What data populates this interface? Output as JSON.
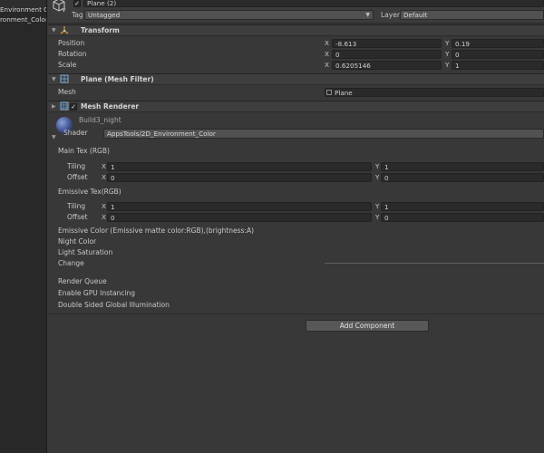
{
  "hierarchy": {
    "items": [
      "Environment Co",
      "ronment_Color"
    ]
  },
  "header": {
    "object_name": "Plane (2)",
    "tag_label": "Tag",
    "tag_value": "Untagged",
    "layer_label": "Layer",
    "layer_value": "Default"
  },
  "transform": {
    "title": "Transform",
    "rows": [
      {
        "label": "Position",
        "x": "-8.613",
        "y": "0.19"
      },
      {
        "label": "Rotation",
        "x": "0",
        "y": "0"
      },
      {
        "label": "Scale",
        "x": "0.6205146",
        "y": "1"
      }
    ],
    "axis_x": "X",
    "axis_y": "Y"
  },
  "mesh_filter": {
    "title": "Plane (Mesh Filter)",
    "mesh_label": "Mesh",
    "mesh_value": "Plane"
  },
  "mesh_renderer": {
    "title": "Mesh Renderer"
  },
  "material": {
    "name": "Build3_night",
    "shader_label": "Shader",
    "shader_value": "AppsTools/2D_Environment_Color",
    "main_tex": {
      "label": "Main Tex (RGB)",
      "tiling_label": "Tiling",
      "offset_label": "Offset",
      "tiling_x": "1",
      "tiling_y": "1",
      "offset_x": "0",
      "offset_y": "0"
    },
    "emissive_tex": {
      "label": "Emissive Tex(RGB)",
      "tiling_label": "Tiling",
      "offset_label": "Offset",
      "tiling_x": "1",
      "tiling_y": "1",
      "offset_x": "0",
      "offset_y": "0"
    },
    "emissive_color_label": "Emissive Color (Emissive matte color:RGB),(brightness:A)",
    "night_color_label": "Night Color",
    "light_saturation_label": "Light Saturation",
    "change_label": "Change",
    "render_queue_label": "Render Queue",
    "gpu_instancing_label": "Enable GPU Instancing",
    "double_sided_label": "Double Sided Global Illumination"
  },
  "add_component_label": "Add Component",
  "colors": {
    "background": "#383838",
    "field": "#2a2a2a",
    "header": "#3e3e3e",
    "button": "#585858"
  }
}
